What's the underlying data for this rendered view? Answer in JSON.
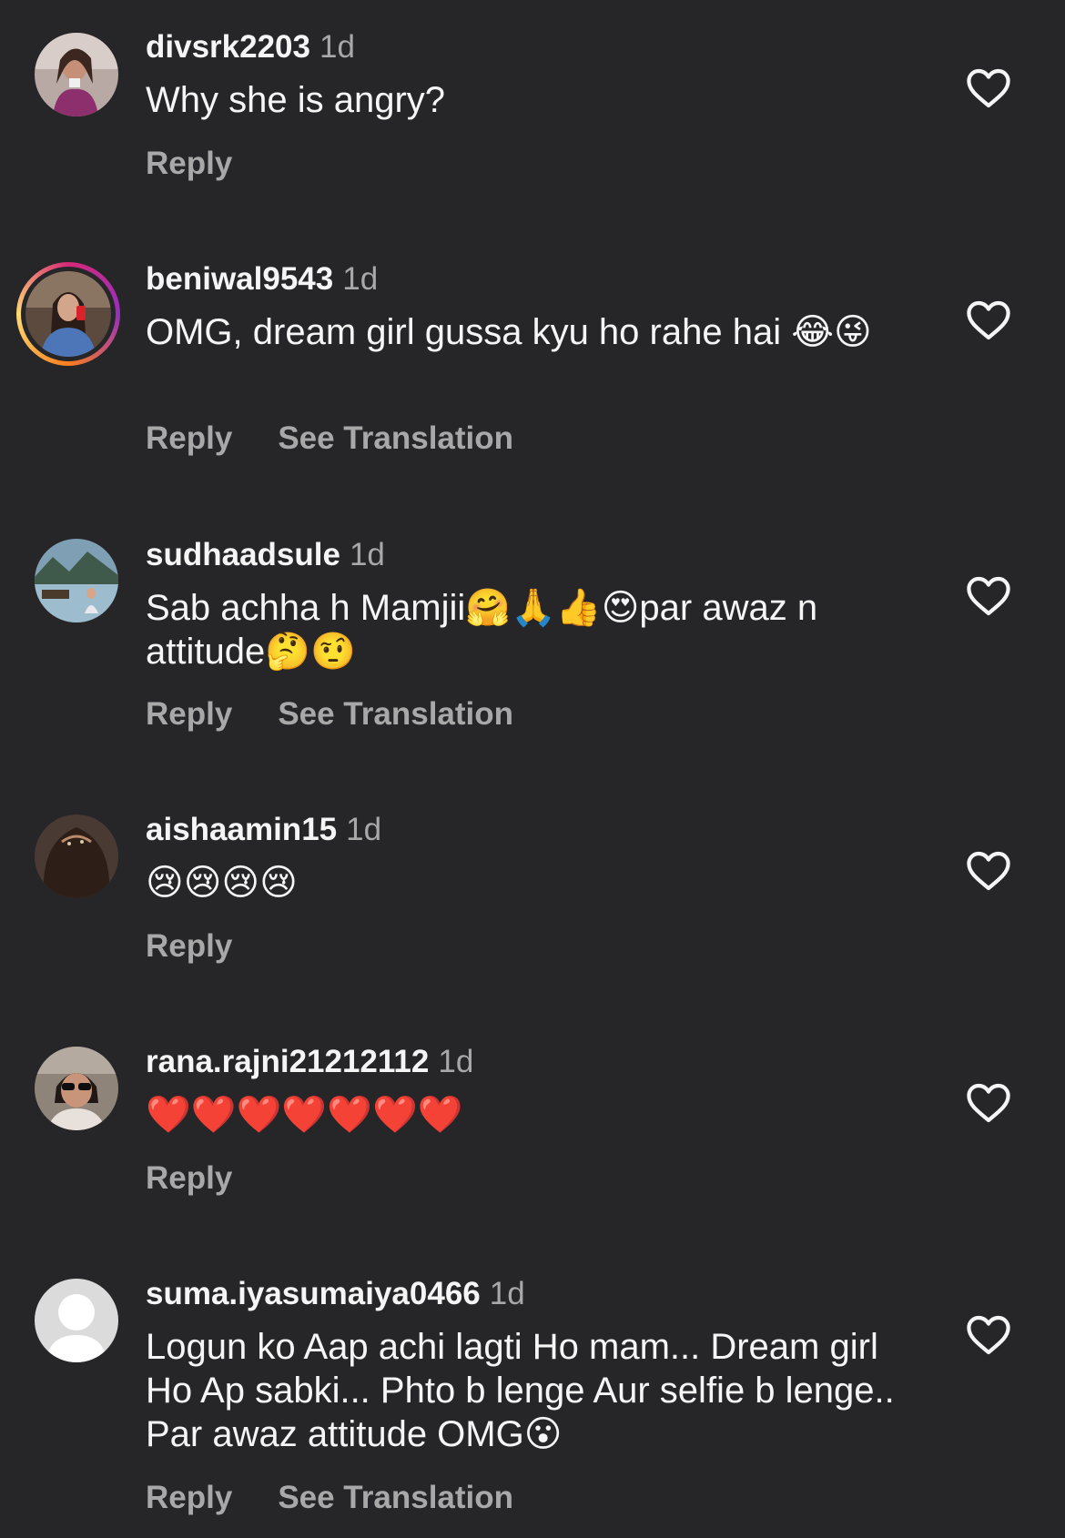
{
  "comments": [
    {
      "username": "divsrk2203",
      "time": "1d",
      "text": "Why she is angry?",
      "reply_label": "Reply",
      "translate_label": ""
    },
    {
      "username": "beniwal9543",
      "time": "1d",
      "text": "OMG, dream girl gussa kyu ho rahe hai 😂😜",
      "reply_label": "Reply",
      "translate_label": "See Translation"
    },
    {
      "username": "sudhaadsule",
      "time": "1d",
      "text": "Sab achha h Mamjii🤗🙏👍😍par awaz n attitude🤔🤨",
      "reply_label": "Reply",
      "translate_label": "See Translation"
    },
    {
      "username": "aishaamin15",
      "time": "1d",
      "text": "😢😢😢😢",
      "reply_label": "Reply",
      "translate_label": ""
    },
    {
      "username": "rana.rajni21212112",
      "time": "1d",
      "text": "❤️❤️❤️❤️❤️❤️❤️",
      "reply_label": "Reply",
      "translate_label": ""
    },
    {
      "username": "suma.iyasumaiya0466",
      "time": "1d",
      "text": "Logun ko Aap achi lagti Ho mam... Dream girl Ho Ap sabki... Phto b lenge Aur selfie b lenge.. Par awaz attitude  OMG😮",
      "reply_label": "Reply",
      "translate_label": "See Translation"
    }
  ],
  "icons": {
    "like": "heart-outline-icon",
    "default_avatar": "person-silhouette-icon"
  },
  "colors": {
    "background": "#262628",
    "primary_text": "#f5f5f5",
    "secondary_text": "#a8a8a8",
    "story_ring": [
      "#d62976",
      "#962fbf",
      "#fa7e1e",
      "#feda75"
    ]
  }
}
